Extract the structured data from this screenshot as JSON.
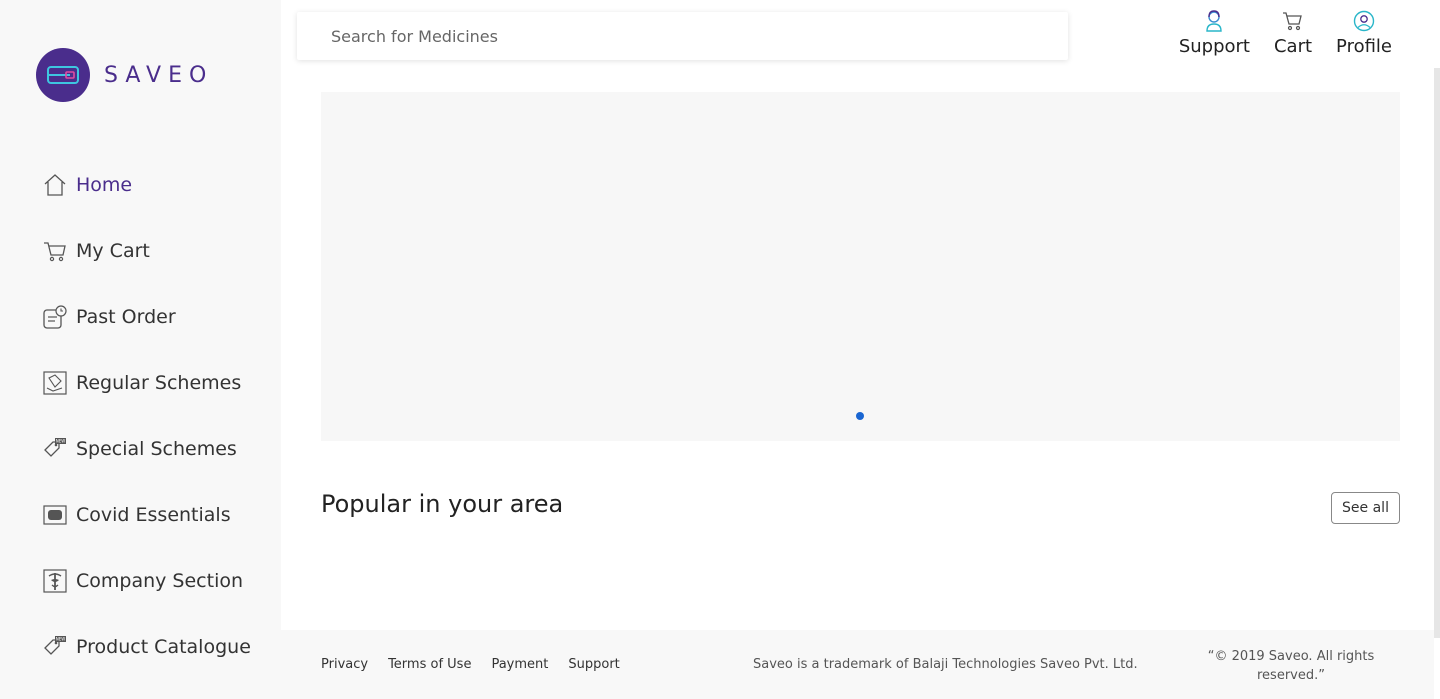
{
  "brand": {
    "name": "SAVEO",
    "color": "#4a2d8c"
  },
  "search": {
    "placeholder": "Search for Medicines"
  },
  "header": {
    "actions": [
      {
        "label": "Support",
        "icon": "support-agent-icon"
      },
      {
        "label": "Cart",
        "icon": "cart-icon"
      },
      {
        "label": "Profile",
        "icon": "profile-icon"
      }
    ]
  },
  "sidebar": {
    "items": [
      {
        "label": "Home",
        "icon": "home-icon",
        "active": true
      },
      {
        "label": "My Cart",
        "icon": "cart-icon"
      },
      {
        "label": "Past Order",
        "icon": "past-order-icon"
      },
      {
        "label": "Regular Schemes",
        "icon": "scheme-icon"
      },
      {
        "label": "Special Schemes",
        "icon": "new-tag-icon"
      },
      {
        "label": "Covid Essentials",
        "icon": "covid-icon"
      },
      {
        "label": "Company Section",
        "icon": "company-icon"
      },
      {
        "label": "Product Catalogue",
        "icon": "new-tag-icon"
      }
    ]
  },
  "main": {
    "popular_title": "Popular in your area",
    "see_all": "See all",
    "carousel_indicator_color": "#1a66d2"
  },
  "footer": {
    "links": [
      "Privacy",
      "Terms of Use",
      "Payment",
      "Support"
    ],
    "trademark": "Saveo is a trademark of Balaji Technologies Saveo Pvt. Ltd.",
    "copyright": "“© 2019 Saveo. All rights reserved.”"
  }
}
